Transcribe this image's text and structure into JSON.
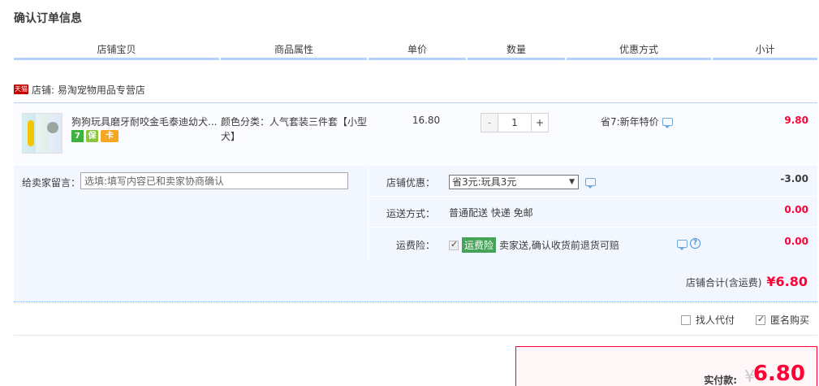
{
  "page_title": "确认订单信息",
  "columns": [
    "店铺宝贝",
    "商品属性",
    "单价",
    "数量",
    "优惠方式",
    "小计"
  ],
  "shop": {
    "badge": "天猫",
    "label": "店铺: 易淘宠物用品专营店"
  },
  "item": {
    "name": "狗狗玩具磨牙耐咬金毛泰迪幼犬...",
    "attr": "颜色分类：人气套装三件套【小型犬】",
    "price": "16.80",
    "qty_minus": "-",
    "quantity": "1",
    "qty_plus": "+",
    "discount": "省7:新年特价",
    "subtotal": "9.80",
    "service_icons": [
      "7",
      "保",
      "卡"
    ]
  },
  "memo": {
    "label": "给卖家留言：",
    "placeholder": "选填:填写内容已和卖家协商确认"
  },
  "shop_coupon": {
    "label": "店铺优惠：",
    "selected": "省3元:玩具3元",
    "amount": "-3.00"
  },
  "shipping": {
    "label": "运送方式：",
    "value": "普通配送 快递 免邮",
    "amount": "0.00"
  },
  "insurance": {
    "label": "运费险：",
    "badge": "运费险",
    "text": "卖家送,确认收货前退货可赔",
    "amount": "0.00",
    "help": "?"
  },
  "shop_total": {
    "label": "店铺合计(含运费)",
    "value": "¥6.80"
  },
  "footer": {
    "proxy_pay": "找人代付",
    "anonymous": "匿名购买"
  },
  "payment": {
    "label": "实付款:",
    "currency": "¥",
    "amount": "6.80"
  }
}
